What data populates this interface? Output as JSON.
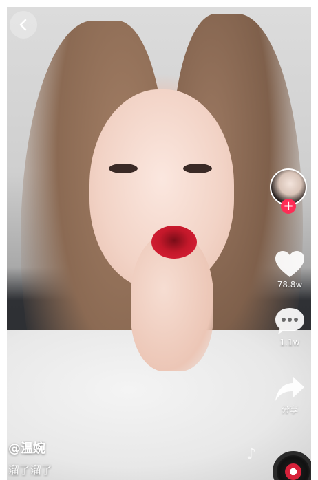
{
  "author": {
    "handle": "@温婉"
  },
  "caption": "溜了溜了",
  "actions": {
    "likes": "78.8w",
    "comments": "1.1w",
    "share_label": "分享"
  },
  "icons": {
    "back": "chevron-left-icon",
    "follow": "plus-icon",
    "like": "heart-icon",
    "comment": "comment-bubble-icon",
    "share": "share-arrow-icon",
    "music": "music-note-icon"
  },
  "colors": {
    "accent": "#fe2c55",
    "text": "#ffffff"
  }
}
